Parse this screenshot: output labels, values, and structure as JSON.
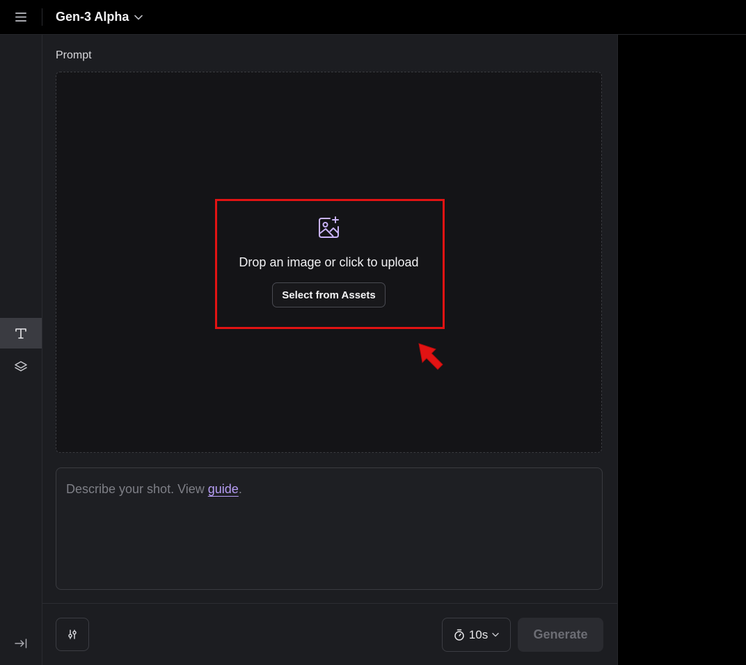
{
  "topbar": {
    "menu_icon": "hamburger-icon",
    "model_name": "Gen-3 Alpha",
    "model_chevron_icon": "chevron-down-icon"
  },
  "sidebar": {
    "items": [
      {
        "icon": "text-icon",
        "label": "T",
        "active": true
      },
      {
        "icon": "layers-icon",
        "active": false
      }
    ],
    "collapse_icon": "collapse-arrow-icon"
  },
  "prompt": {
    "label": "Prompt",
    "dropzone": {
      "icon": "image-plus-icon",
      "text": "Drop an image or click to upload",
      "assets_button": "Select from Assets"
    },
    "textarea": {
      "placeholder_prefix": "Describe your shot. View ",
      "guide_link": "guide",
      "placeholder_suffix": "."
    }
  },
  "footer": {
    "settings_icon": "sliders-icon",
    "duration": {
      "icon": "stopwatch-icon",
      "value": "10s",
      "chevron_icon": "chevron-down-icon"
    },
    "generate_label": "Generate"
  },
  "annotation": {
    "highlight_color": "#e21313",
    "arrow_icon": "red-arrow-icon"
  },
  "colors": {
    "background": "#000000",
    "panel": "#1c1d21",
    "dropzone": "#141417",
    "accent": "#b79ef5"
  }
}
